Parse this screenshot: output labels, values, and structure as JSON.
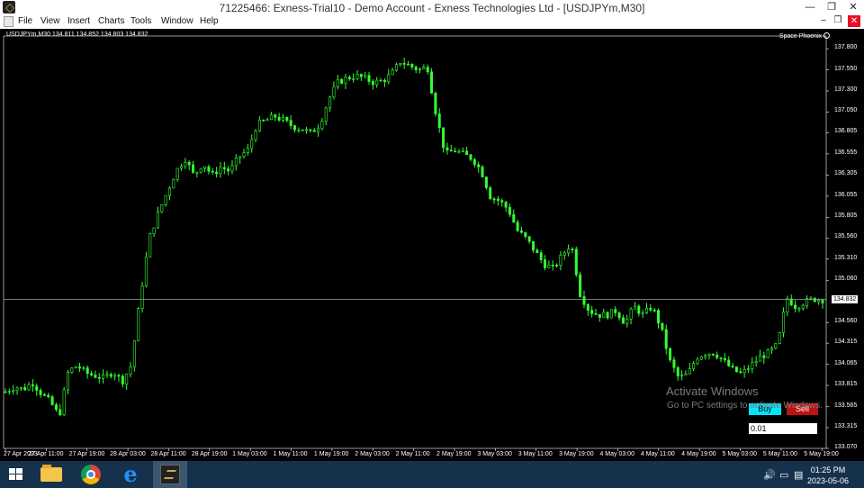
{
  "window": {
    "title": "71225466: Exness-Trial10 - Demo Account - Exness Technologies Ltd - [USDJPYm,M30]",
    "controls": {
      "minimize": "—",
      "maximize": "❐",
      "close": "✕"
    }
  },
  "menu": {
    "items": [
      "File",
      "View",
      "Insert",
      "Charts",
      "Tools",
      "Window",
      "Help"
    ],
    "mdi_controls": {
      "minimize": "–",
      "restore": "❐",
      "close": "✕"
    }
  },
  "chart": {
    "symbol_info": "USDJPYm,M30  134.811 134.852 134.803 134.832",
    "watermark": "Space Phoenix",
    "current_price": "134.832",
    "candle_color": "#33ff33",
    "price_line_color": "#a0a0a0"
  },
  "chart_data": {
    "type": "line",
    "title": "",
    "xlabel": "",
    "ylabel": "",
    "ylim": [
      133.07,
      137.95
    ],
    "y_ticks": [
      "137.800",
      "137.550",
      "137.300",
      "137.050",
      "136.805",
      "136.555",
      "136.305",
      "136.055",
      "135.805",
      "135.560",
      "135.310",
      "135.060",
      "134.832",
      "134.560",
      "134.315",
      "134.065",
      "133.815",
      "133.565",
      "133.315",
      "133.070"
    ],
    "x_ticks": [
      "27 Apr 2023",
      "27 Apr 11:00",
      "27 Apr 19:00",
      "28 Apr 03:00",
      "28 Apr 11:00",
      "28 Apr 19:00",
      "1 May 03:00",
      "1 May 11:00",
      "1 May 19:00",
      "2 May 03:00",
      "2 May 11:00",
      "2 May 19:00",
      "3 May 03:00",
      "3 May 11:00",
      "3 May 19:00",
      "4 May 03:00",
      "4 May 11:00",
      "4 May 19:00",
      "5 May 03:00",
      "5 May 11:00",
      "5 May 19:00"
    ],
    "series": [
      {
        "values": [
          133.74,
          133.8,
          133.77,
          133.85,
          133.72,
          133.62,
          133.45,
          133.98,
          134.05,
          133.96,
          133.93,
          133.9,
          133.98,
          133.86,
          134.05,
          134.85,
          135.55,
          135.85,
          136.1,
          136.35,
          136.5,
          136.3,
          136.45,
          136.3,
          136.4,
          136.35,
          136.52,
          136.6,
          136.9,
          136.95,
          137.0,
          136.95,
          136.88,
          136.85,
          136.8,
          136.9,
          137.2,
          137.4,
          137.45,
          137.48,
          137.45,
          137.4,
          137.42,
          137.5,
          137.65,
          137.6,
          137.55,
          137.58,
          137.0,
          136.55,
          136.6,
          136.55,
          136.5,
          136.35,
          136.05,
          136.0,
          135.9,
          135.65,
          135.55,
          135.4,
          135.25,
          135.2,
          135.35,
          135.5,
          134.9,
          134.7,
          134.65,
          134.65,
          134.7,
          134.55,
          134.75,
          134.65,
          134.75,
          134.5,
          134.1,
          133.9,
          133.95,
          134.15,
          134.2,
          134.2,
          134.1,
          134.0,
          133.95,
          134.05,
          134.15,
          134.2,
          134.3,
          134.85,
          134.75,
          134.8,
          134.84,
          134.83
        ]
      }
    ]
  },
  "trade_panel": {
    "buy_label": "Buy",
    "sell_label": "Sell",
    "lot_value": "0.01"
  },
  "activation": {
    "title": "Activate Windows",
    "subtitle": "Go to PC settings to activate Windows."
  },
  "taskbar": {
    "apps": [
      "file-explorer",
      "chrome",
      "internet-explorer",
      "exness-terminal"
    ],
    "clock_time": "01:25 PM",
    "clock_date": "2023-05-06"
  }
}
